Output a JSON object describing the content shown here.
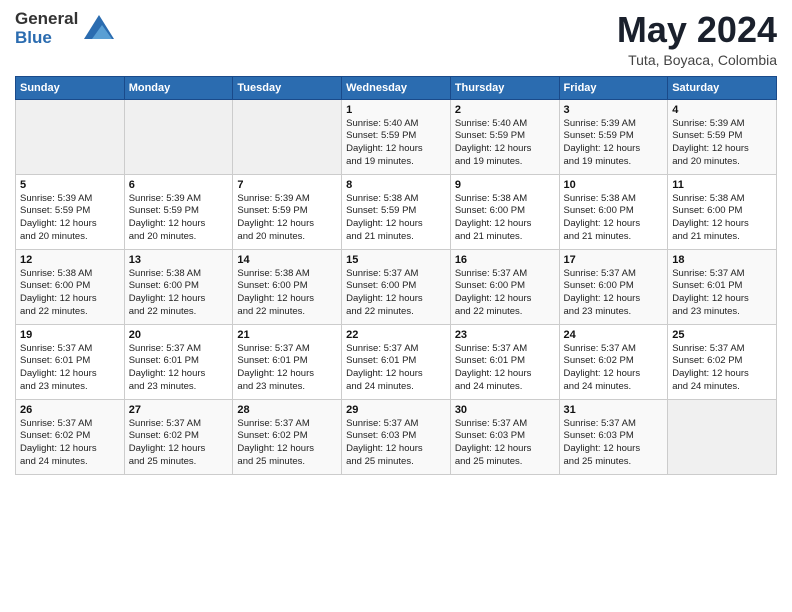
{
  "header": {
    "logo_general": "General",
    "logo_blue": "Blue",
    "month_title": "May 2024",
    "location": "Tuta, Boyaca, Colombia"
  },
  "days_of_week": [
    "Sunday",
    "Monday",
    "Tuesday",
    "Wednesday",
    "Thursday",
    "Friday",
    "Saturday"
  ],
  "weeks": [
    [
      {
        "day": "",
        "info": ""
      },
      {
        "day": "",
        "info": ""
      },
      {
        "day": "",
        "info": ""
      },
      {
        "day": "1",
        "info": "Sunrise: 5:40 AM\nSunset: 5:59 PM\nDaylight: 12 hours\nand 19 minutes."
      },
      {
        "day": "2",
        "info": "Sunrise: 5:40 AM\nSunset: 5:59 PM\nDaylight: 12 hours\nand 19 minutes."
      },
      {
        "day": "3",
        "info": "Sunrise: 5:39 AM\nSunset: 5:59 PM\nDaylight: 12 hours\nand 19 minutes."
      },
      {
        "day": "4",
        "info": "Sunrise: 5:39 AM\nSunset: 5:59 PM\nDaylight: 12 hours\nand 20 minutes."
      }
    ],
    [
      {
        "day": "5",
        "info": "Sunrise: 5:39 AM\nSunset: 5:59 PM\nDaylight: 12 hours\nand 20 minutes."
      },
      {
        "day": "6",
        "info": "Sunrise: 5:39 AM\nSunset: 5:59 PM\nDaylight: 12 hours\nand 20 minutes."
      },
      {
        "day": "7",
        "info": "Sunrise: 5:39 AM\nSunset: 5:59 PM\nDaylight: 12 hours\nand 20 minutes."
      },
      {
        "day": "8",
        "info": "Sunrise: 5:38 AM\nSunset: 5:59 PM\nDaylight: 12 hours\nand 21 minutes."
      },
      {
        "day": "9",
        "info": "Sunrise: 5:38 AM\nSunset: 6:00 PM\nDaylight: 12 hours\nand 21 minutes."
      },
      {
        "day": "10",
        "info": "Sunrise: 5:38 AM\nSunset: 6:00 PM\nDaylight: 12 hours\nand 21 minutes."
      },
      {
        "day": "11",
        "info": "Sunrise: 5:38 AM\nSunset: 6:00 PM\nDaylight: 12 hours\nand 21 minutes."
      }
    ],
    [
      {
        "day": "12",
        "info": "Sunrise: 5:38 AM\nSunset: 6:00 PM\nDaylight: 12 hours\nand 22 minutes."
      },
      {
        "day": "13",
        "info": "Sunrise: 5:38 AM\nSunset: 6:00 PM\nDaylight: 12 hours\nand 22 minutes."
      },
      {
        "day": "14",
        "info": "Sunrise: 5:38 AM\nSunset: 6:00 PM\nDaylight: 12 hours\nand 22 minutes."
      },
      {
        "day": "15",
        "info": "Sunrise: 5:37 AM\nSunset: 6:00 PM\nDaylight: 12 hours\nand 22 minutes."
      },
      {
        "day": "16",
        "info": "Sunrise: 5:37 AM\nSunset: 6:00 PM\nDaylight: 12 hours\nand 22 minutes."
      },
      {
        "day": "17",
        "info": "Sunrise: 5:37 AM\nSunset: 6:00 PM\nDaylight: 12 hours\nand 23 minutes."
      },
      {
        "day": "18",
        "info": "Sunrise: 5:37 AM\nSunset: 6:01 PM\nDaylight: 12 hours\nand 23 minutes."
      }
    ],
    [
      {
        "day": "19",
        "info": "Sunrise: 5:37 AM\nSunset: 6:01 PM\nDaylight: 12 hours\nand 23 minutes."
      },
      {
        "day": "20",
        "info": "Sunrise: 5:37 AM\nSunset: 6:01 PM\nDaylight: 12 hours\nand 23 minutes."
      },
      {
        "day": "21",
        "info": "Sunrise: 5:37 AM\nSunset: 6:01 PM\nDaylight: 12 hours\nand 23 minutes."
      },
      {
        "day": "22",
        "info": "Sunrise: 5:37 AM\nSunset: 6:01 PM\nDaylight: 12 hours\nand 24 minutes."
      },
      {
        "day": "23",
        "info": "Sunrise: 5:37 AM\nSunset: 6:01 PM\nDaylight: 12 hours\nand 24 minutes."
      },
      {
        "day": "24",
        "info": "Sunrise: 5:37 AM\nSunset: 6:02 PM\nDaylight: 12 hours\nand 24 minutes."
      },
      {
        "day": "25",
        "info": "Sunrise: 5:37 AM\nSunset: 6:02 PM\nDaylight: 12 hours\nand 24 minutes."
      }
    ],
    [
      {
        "day": "26",
        "info": "Sunrise: 5:37 AM\nSunset: 6:02 PM\nDaylight: 12 hours\nand 24 minutes."
      },
      {
        "day": "27",
        "info": "Sunrise: 5:37 AM\nSunset: 6:02 PM\nDaylight: 12 hours\nand 25 minutes."
      },
      {
        "day": "28",
        "info": "Sunrise: 5:37 AM\nSunset: 6:02 PM\nDaylight: 12 hours\nand 25 minutes."
      },
      {
        "day": "29",
        "info": "Sunrise: 5:37 AM\nSunset: 6:03 PM\nDaylight: 12 hours\nand 25 minutes."
      },
      {
        "day": "30",
        "info": "Sunrise: 5:37 AM\nSunset: 6:03 PM\nDaylight: 12 hours\nand 25 minutes."
      },
      {
        "day": "31",
        "info": "Sunrise: 5:37 AM\nSunset: 6:03 PM\nDaylight: 12 hours\nand 25 minutes."
      },
      {
        "day": "",
        "info": ""
      }
    ]
  ]
}
